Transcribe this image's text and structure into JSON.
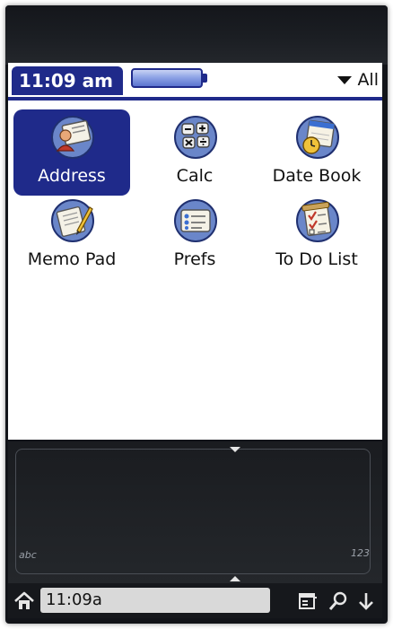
{
  "status_bar": {
    "time": "11:09 am",
    "category": "All"
  },
  "apps": [
    {
      "label": "Address",
      "icon": "address-book-icon",
      "selected": true
    },
    {
      "label": "Calc",
      "icon": "calculator-icon",
      "selected": false
    },
    {
      "label": "Date Book",
      "icon": "calendar-clock-icon",
      "selected": false
    },
    {
      "label": "Memo Pad",
      "icon": "notepad-pencil-icon",
      "selected": false
    },
    {
      "label": "Prefs",
      "icon": "preferences-card-icon",
      "selected": false
    },
    {
      "label": "To Do List",
      "icon": "checklist-icon",
      "selected": false
    }
  ],
  "graffiti": {
    "hint_left": "abc",
    "hint_right": "123"
  },
  "dock": {
    "time": "11:09a",
    "icons": [
      "home-icon",
      "menu-icon",
      "find-icon",
      "keyboard-down-icon"
    ]
  },
  "colors": {
    "accent": "#1f2a8a",
    "bezel": "#121419",
    "field": "#d9d9d9"
  }
}
